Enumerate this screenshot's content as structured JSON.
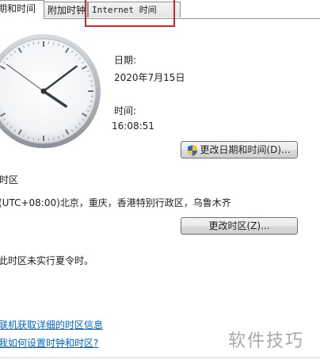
{
  "tabs": [
    {
      "label": "期和时间",
      "active": true
    },
    {
      "label": "附加时钟",
      "active": false
    },
    {
      "label": "Internet 时间",
      "active": false,
      "highlighted": true
    }
  ],
  "highlight_color": "#d0262a",
  "clock": {
    "hour": 16,
    "minute": 8,
    "second": 51
  },
  "date_label": "日期:",
  "date_value": "2020年7月15日",
  "time_label": "时间:",
  "time_value": "16:08:51",
  "change_datetime_button": "更改日期和时间(D)...",
  "timezone_label": "时区",
  "timezone_value": "(UTC+08:00)北京，重庆，香港特别行政区，乌鲁木齐",
  "change_timezone_button": "更改时区(Z)...",
  "dst_note": "此时区未实行夏令时。",
  "links": {
    "online_tz_info": "联机获取详细的时区信息",
    "how_to_set": "我如何设置时钟和时区?"
  },
  "watermark": "软件技巧",
  "icons": {
    "shield": "uac-shield-icon"
  }
}
